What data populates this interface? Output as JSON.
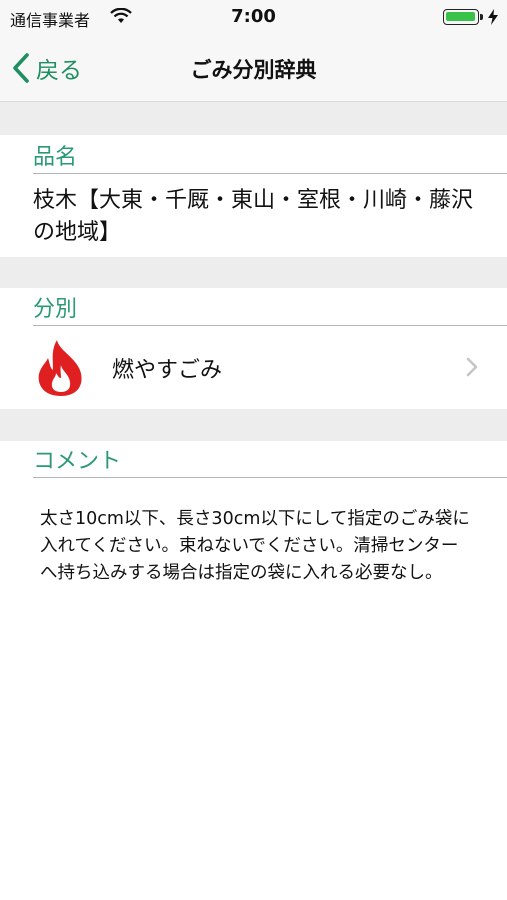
{
  "status_bar": {
    "carrier": "通信事業者",
    "time": "7:00",
    "battery_level": 1.0
  },
  "nav": {
    "back_label": "戻る",
    "title": "ごみ分別辞典",
    "accent_color": "#1e8f62"
  },
  "sections": {
    "name_header": "品名",
    "name_value": "枝木【大東・千厩・東山・室根・川崎・藤沢の地域】",
    "category_header": "分別",
    "category_value": "燃やすごみ",
    "category_icon": "fire-icon",
    "comment_header": "コメント",
    "comment_value": "太さ10cm以下、長さ30cm以下にして指定のごみ袋に入れてください。束ねないでください。清掃センターへ持ち込みする場合は指定の袋に入れる必要なし。"
  }
}
